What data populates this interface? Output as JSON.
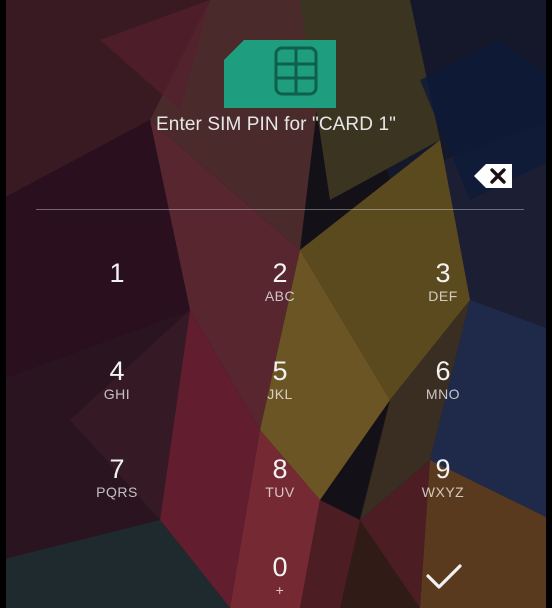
{
  "prompt": {
    "text": "Enter SIM PIN for \"CARD 1\""
  },
  "pin_field": {
    "value": ""
  },
  "keypad": {
    "keys": [
      {
        "digit": "1",
        "letters": ""
      },
      {
        "digit": "2",
        "letters": "ABC"
      },
      {
        "digit": "3",
        "letters": "DEF"
      },
      {
        "digit": "4",
        "letters": "GHI"
      },
      {
        "digit": "5",
        "letters": "JKL"
      },
      {
        "digit": "6",
        "letters": "MNO"
      },
      {
        "digit": "7",
        "letters": "PQRS"
      },
      {
        "digit": "8",
        "letters": "TUV"
      },
      {
        "digit": "9",
        "letters": "WXYZ"
      },
      {
        "digit": "0",
        "letters": "+"
      }
    ]
  },
  "icons": {
    "sim": "sim-card-icon",
    "delete": "backspace-icon",
    "enter": "checkmark-icon"
  },
  "colors": {
    "sim_icon": "#1e9e7f",
    "text": "#ffffff"
  }
}
